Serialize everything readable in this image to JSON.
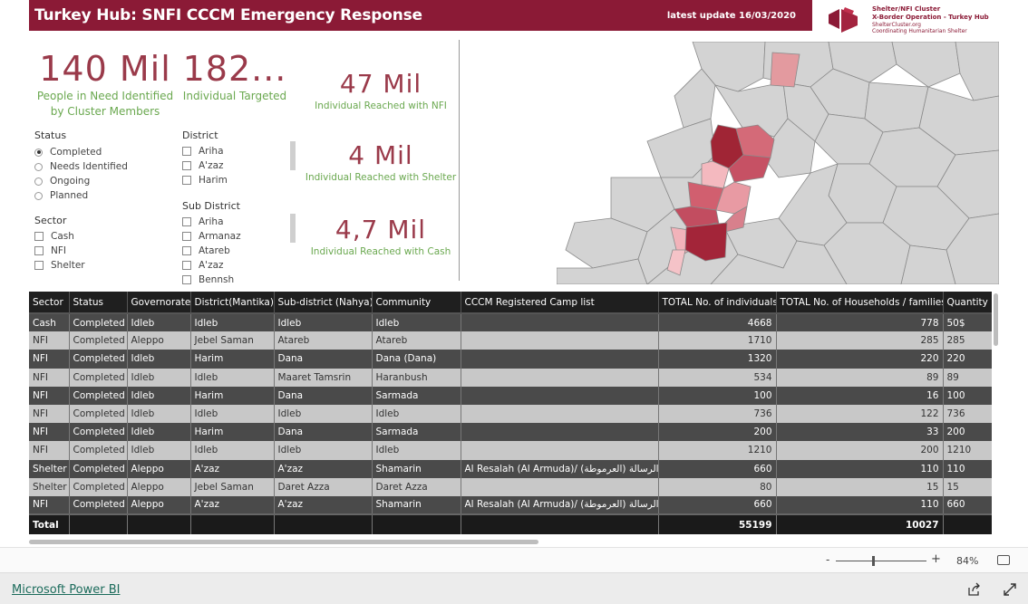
{
  "header": {
    "title": "Turkey Hub: SNFI CCCM Emergency Response",
    "update": "latest update  16/03/2020"
  },
  "logo": {
    "line1": "Shelter/NFI Cluster",
    "line2": "X-Border Operation - Turkey Hub",
    "line3": "ShelterCluster.org",
    "line4": "Coordinating Humanitarian Shelter"
  },
  "kpis": {
    "pin": {
      "value": "140 Mil",
      "label1": "People in Need Identified",
      "label2": "by Cluster Members"
    },
    "targeted": {
      "value": "182...",
      "label": "Individual Targeted"
    },
    "nfi": {
      "value": "47 Mil",
      "label": "Individual Reached with NFI"
    },
    "shelter": {
      "value": "4 Mil",
      "label": "Individual Reached with Shelter"
    },
    "cash": {
      "value": "4,7 Mil",
      "label": "Individual Reached with Cash"
    }
  },
  "slicers": {
    "status": {
      "title": "Status",
      "items": [
        "Completed",
        "Needs Identified",
        "Ongoing",
        "Planned"
      ],
      "selected": "Completed"
    },
    "sector": {
      "title": "Sector",
      "items": [
        "Cash",
        "NFI",
        "Shelter"
      ]
    },
    "district": {
      "title": "District",
      "items": [
        "Ariha",
        "A'zaz",
        "Harim"
      ]
    },
    "subdistrict": {
      "title": "Sub District",
      "items": [
        "Ariha",
        "Armanaz",
        "Atareb",
        "A'zaz",
        "Bennsh"
      ]
    }
  },
  "table": {
    "columns": [
      "Sector",
      "Status",
      "Governorate",
      "District(Mantika)",
      "Sub-district (Nahya)",
      "Community",
      "CCCM Registered Camp list",
      "TOTAL No. of individuals",
      "TOTAL No. of Households / families",
      "Quantity (in"
    ],
    "rows": [
      [
        "Cash",
        "Completed",
        "Idleb",
        "Idleb",
        "Idleb",
        "Idleb",
        "",
        "4668",
        "778",
        "50$"
      ],
      [
        "NFI",
        "Completed",
        "Aleppo",
        "Jebel Saman",
        "Atareb",
        "Atareb",
        "",
        "1710",
        "285",
        "285"
      ],
      [
        "NFI",
        "Completed",
        "Idleb",
        "Harim",
        "Dana",
        "Dana (Dana)",
        "",
        "1320",
        "220",
        "220"
      ],
      [
        "NFI",
        "Completed",
        "Idleb",
        "Idleb",
        "Maaret Tamsrin",
        "Haranbush",
        "",
        "534",
        "89",
        "89"
      ],
      [
        "NFI",
        "Completed",
        "Idleb",
        "Harim",
        "Dana",
        "Sarmada",
        "",
        "100",
        "16",
        "100"
      ],
      [
        "NFI",
        "Completed",
        "Idleb",
        "Idleb",
        "Idleb",
        "Idleb",
        "",
        "736",
        "122",
        "736"
      ],
      [
        "NFI",
        "Completed",
        "Idleb",
        "Harim",
        "Dana",
        "Sarmada",
        "",
        "200",
        "33",
        "200"
      ],
      [
        "NFI",
        "Completed",
        "Idleb",
        "Idleb",
        "Idleb",
        "Idleb",
        "",
        "1210",
        "200",
        "1210"
      ],
      [
        "Shelter",
        "Completed",
        "Aleppo",
        "A'zaz",
        "A'zaz",
        "Shamarin",
        "Al Resalah (Al Armuda)/ (الرسالة (العرموطة",
        "660",
        "110",
        "110"
      ],
      [
        "Shelter",
        "Completed",
        "Aleppo",
        "Jebel Saman",
        "Daret Azza",
        "Daret Azza",
        "",
        "80",
        "15",
        "15"
      ],
      [
        "NFI",
        "Completed",
        "Aleppo",
        "A'zaz",
        "A'zaz",
        "Shamarin",
        "Al Resalah (Al Armuda)/ (الرسالة (العرموطة",
        "660",
        "110",
        "660"
      ]
    ],
    "total": {
      "label": "Total",
      "individuals": "55199",
      "households": "10027"
    }
  },
  "zoom": {
    "minus": "-",
    "plus": "+",
    "value": "84%"
  },
  "footer": {
    "brand": "Microsoft Power BI"
  },
  "colors": {
    "header": "#8b1a36",
    "kpi_value": "#9a3a4a",
    "kpi_label": "#6aa84f"
  }
}
